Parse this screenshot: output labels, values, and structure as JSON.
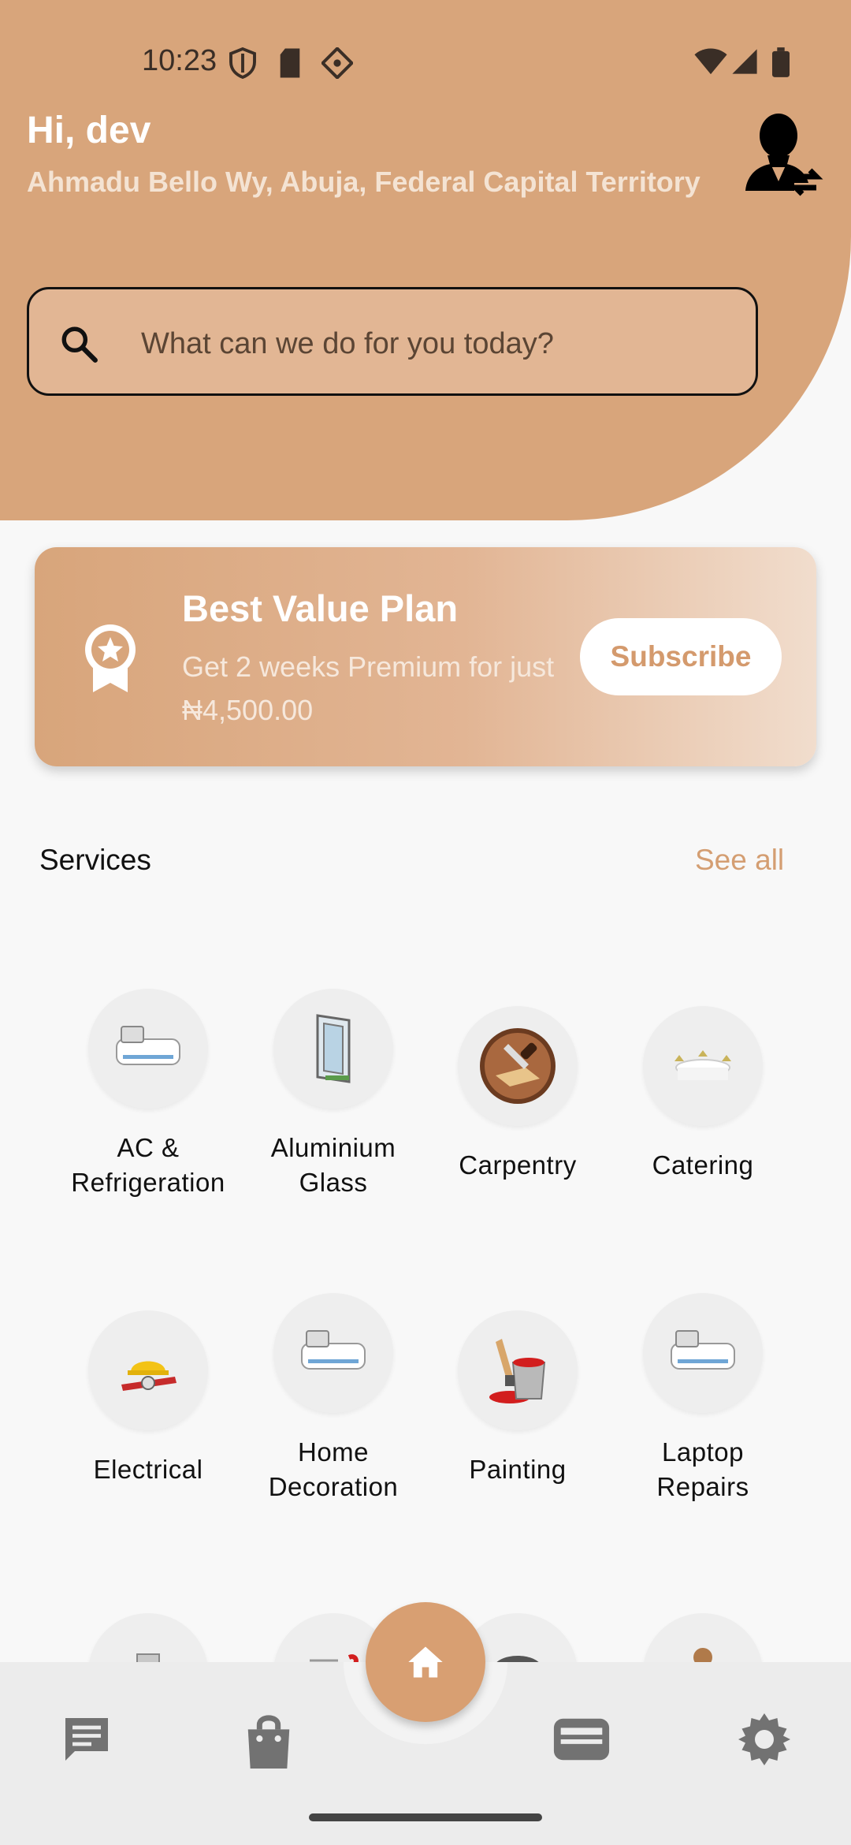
{
  "status": {
    "time": "10:23"
  },
  "header": {
    "greeting": "Hi, dev",
    "location": "Ahmadu Bello Wy, Abuja, Federal Capital Territory"
  },
  "search": {
    "placeholder": "What can we do for you today?"
  },
  "promo": {
    "title": "Best Value Plan",
    "description": "Get 2 weeks Premium for just ₦4,500.00",
    "button": "Subscribe"
  },
  "services": {
    "title": "Services",
    "see_all": "See all",
    "items": [
      {
        "label": "AC & Refrigeration",
        "icon": "air-conditioner-icon"
      },
      {
        "label": "Aluminium Glass",
        "icon": "window-icon"
      },
      {
        "label": "Carpentry",
        "icon": "saw-icon"
      },
      {
        "label": "Catering",
        "icon": "banquet-icon"
      },
      {
        "label": "Electrical",
        "icon": "electrical-tools-icon"
      },
      {
        "label": "Home Decoration",
        "icon": "air-conditioner-icon"
      },
      {
        "label": "Painting",
        "icon": "paint-bucket-icon"
      },
      {
        "label": "Laptop Repairs",
        "icon": "air-conditioner-icon"
      }
    ]
  },
  "nav": {
    "items": [
      "chat-icon",
      "shopping-bag-icon",
      "home-icon",
      "wallet-icon",
      "settings-icon"
    ]
  },
  "colors": {
    "accent": "#d8a57b",
    "accent_text": "#d49a6d"
  }
}
